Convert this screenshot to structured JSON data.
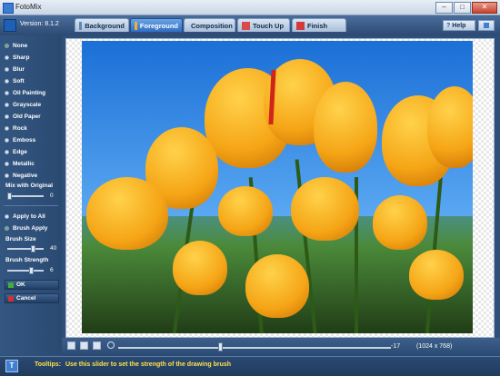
{
  "window": {
    "title": "FotoMix",
    "minimize": "–",
    "maximize": "□",
    "close": "✕"
  },
  "header": {
    "version": "Version: 8.1.2",
    "tabs": [
      {
        "label": "Background",
        "active": false
      },
      {
        "label": "Foreground",
        "active": true
      },
      {
        "label": "Composition",
        "active": false
      },
      {
        "label": "Touch Up",
        "active": false
      },
      {
        "label": "Finish",
        "active": false
      }
    ],
    "help_label": "Help",
    "help_question": "?"
  },
  "effects": {
    "options": [
      "None",
      "Sharp",
      "Blur",
      "Soft",
      "Oil Painting",
      "Grayscale",
      "Old Paper",
      "Rock",
      "Emboss",
      "Edge",
      "Metallic",
      "Negative"
    ],
    "selected": "None",
    "mix_label": "Mix with Original",
    "mix_value": "0"
  },
  "apply": {
    "options": [
      "Apply to All",
      "Brush Apply"
    ],
    "brush_size_label": "Brush Size",
    "brush_size_value": "40",
    "brush_strength_label": "Brush Strength",
    "brush_strength_value": "6",
    "ok_label": "OK",
    "cancel_label": "Cancel"
  },
  "zoom": {
    "value": "-17",
    "image_size": "(1024 x 768)"
  },
  "status": {
    "label": "Tooltips:",
    "text": "Use this slider to set the strength of the drawing brush"
  },
  "colors": {
    "accent": "#2f6fc3",
    "tooltip_text": "#ffe14a"
  }
}
